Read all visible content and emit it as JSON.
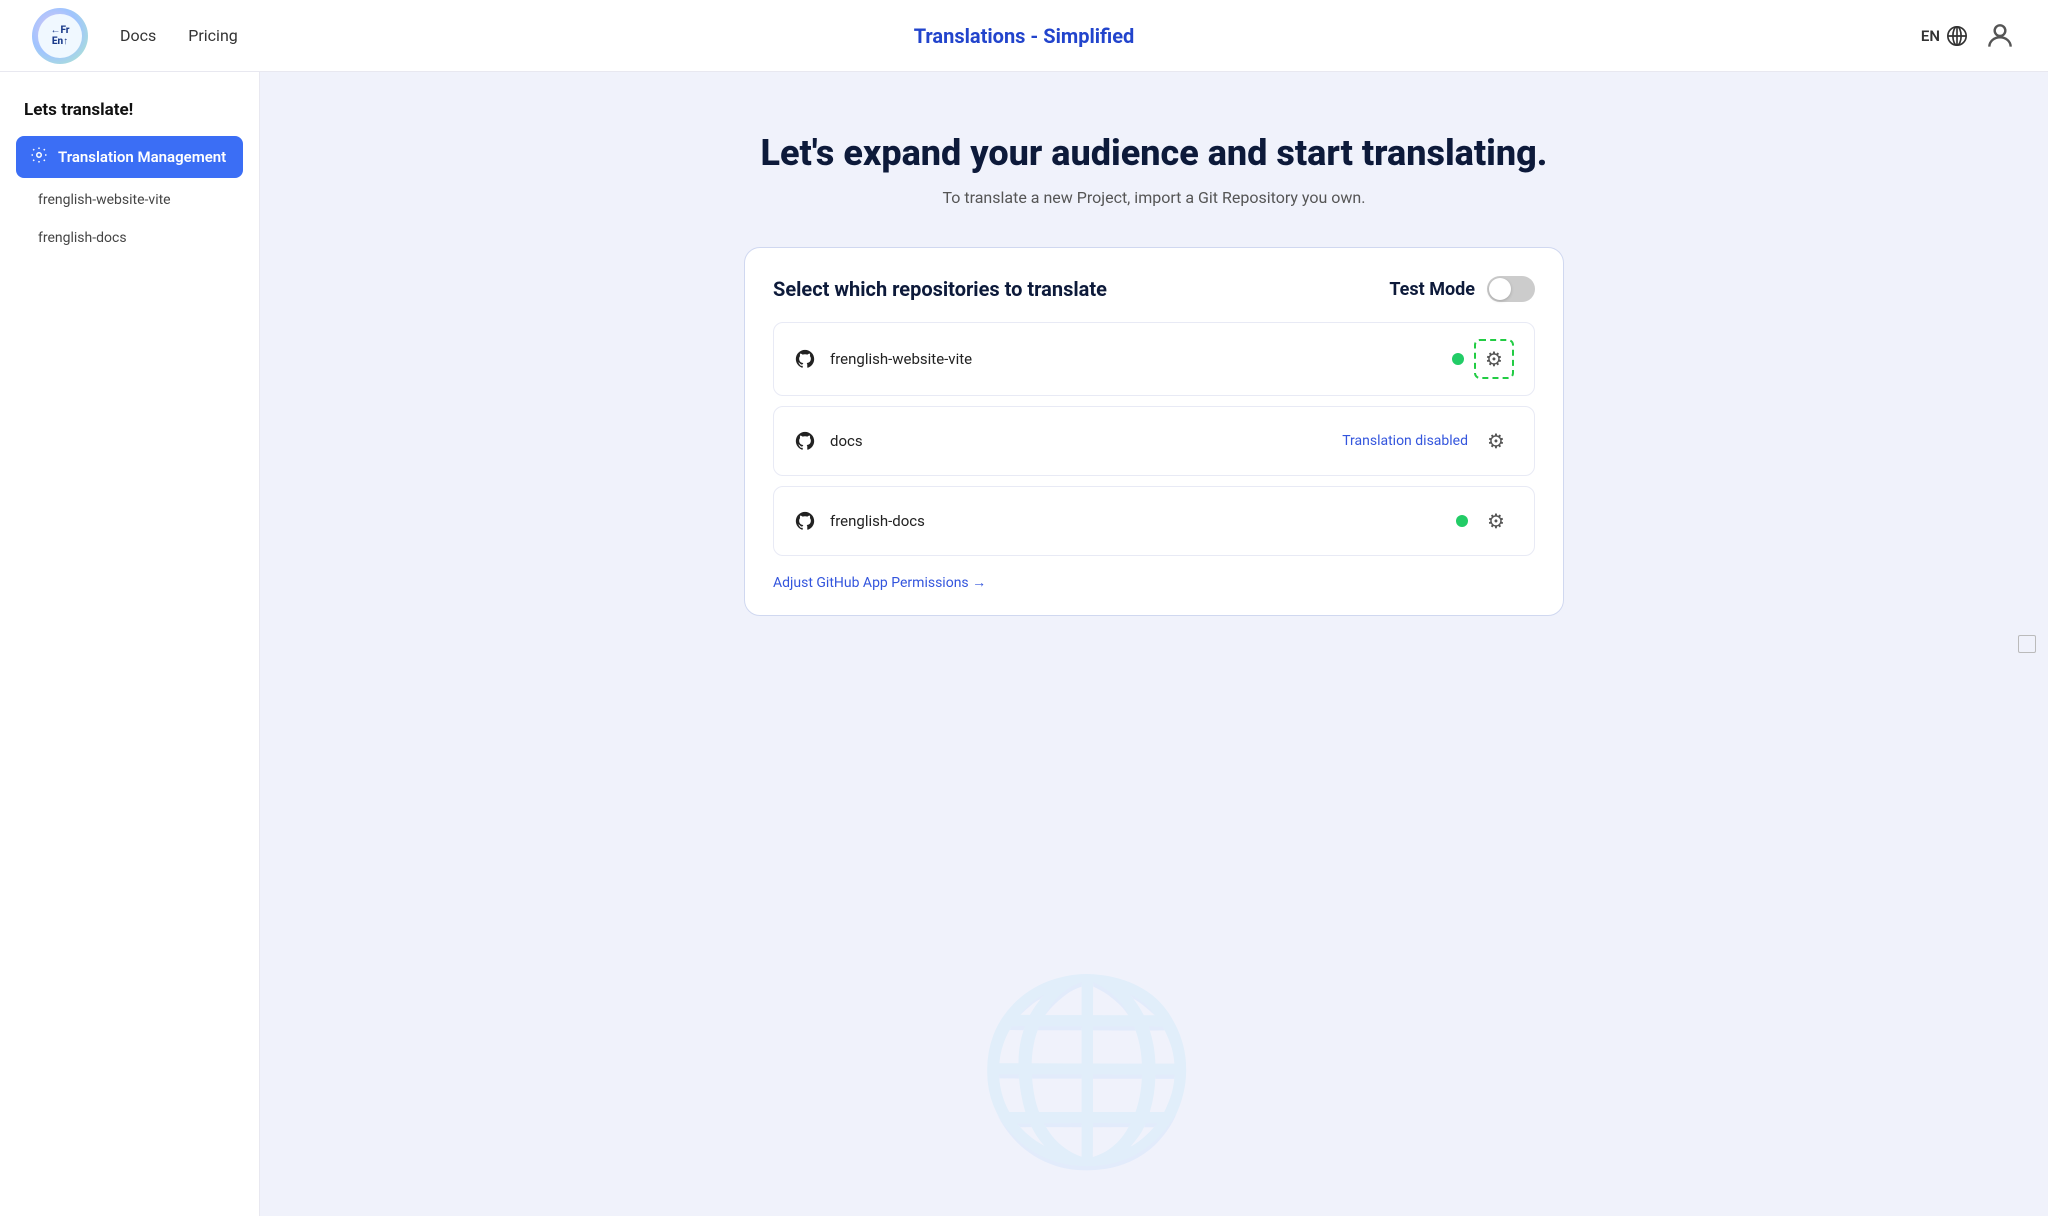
{
  "navbar": {
    "logo_text": "←Fr\nEn↑",
    "nav_links": [
      "Docs",
      "Pricing"
    ],
    "title": "Translations - Simplified",
    "lang": "EN"
  },
  "sidebar": {
    "heading": "Lets translate!",
    "active_item": "Translation Management",
    "active_item_icon": "⚙",
    "subitems": [
      "frenglish-website-vite",
      "frenglish-docs"
    ]
  },
  "main": {
    "hero_title": "Let's expand your audience and start translating.",
    "hero_sub": "To translate a new Project, import a Git Repository you own.",
    "card": {
      "title": "Select which repositories to translate",
      "test_mode_label": "Test Mode",
      "repos": [
        {
          "name": "frenglish-website-vite",
          "status": "active",
          "highlighted": true
        },
        {
          "name": "docs",
          "status": "disabled",
          "disabled_text": "Translation disabled"
        },
        {
          "name": "frenglish-docs",
          "status": "active",
          "highlighted": false
        }
      ],
      "adjust_link": "Adjust GitHub App Permissions →"
    }
  }
}
